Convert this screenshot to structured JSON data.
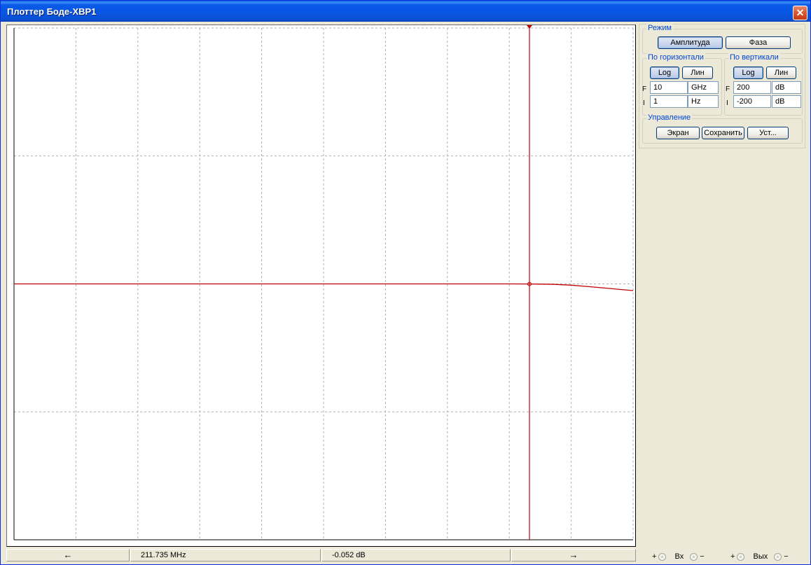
{
  "window": {
    "title": "Плоттер Боде-XBP1",
    "close_glyph": "✕"
  },
  "status": {
    "left_arrow": "←",
    "frequency": "211.735 MHz",
    "magnitude": "-0.052 dB",
    "right_arrow": "→"
  },
  "panel": {
    "mode": {
      "legend": "Режим",
      "amplitude": "Амплитуда",
      "phase": "Фаза"
    },
    "horizontal": {
      "legend": "По горизонтали",
      "log": "Log",
      "lin": "Лин",
      "f_label": "F",
      "f_value": "10",
      "f_unit": "GHz",
      "i_label": "I",
      "i_value": "1",
      "i_unit": "Hz"
    },
    "vertical": {
      "legend": "По вертикали",
      "log": "Log",
      "lin": "Лин",
      "f_label": "F",
      "f_value": "200",
      "f_unit": "dB",
      "i_label": "I",
      "i_value": "-200",
      "i_unit": "dB"
    },
    "control": {
      "legend": "Управление",
      "screen": "Экран",
      "save": "Сохранить",
      "settings": "Уст..."
    }
  },
  "io": {
    "plus": "+",
    "minus": "−",
    "in_label": "Вх",
    "out_label": "Вых"
  },
  "chart_data": {
    "type": "line",
    "x_scale": "log",
    "x_range_hz": [
      1,
      10000000000
    ],
    "y_range_db": [
      -200,
      200
    ],
    "grid": true,
    "grid_divisions_x": 10,
    "grid_divisions_y": 4,
    "series": [
      {
        "color": "#c00000",
        "points": [
          {
            "x": 1,
            "y": 0
          },
          {
            "x": 100000000,
            "y": 0
          },
          {
            "x": 211735000,
            "y": -0.052
          },
          {
            "x": 500000000,
            "y": -0.3
          },
          {
            "x": 1000000000,
            "y": -1
          },
          {
            "x": 2000000000,
            "y": -2.2
          },
          {
            "x": 4000000000,
            "y": -3.5
          },
          {
            "x": 7000000000,
            "y": -4.6
          },
          {
            "x": 10000000000,
            "y": -5.2
          }
        ]
      }
    ],
    "cursor": {
      "x": 211735000,
      "y": -0.052,
      "color": "#c00000"
    },
    "colors": {
      "trace": "#c00000",
      "grid": "#b0b0b0",
      "cursor": "#c00000"
    }
  }
}
